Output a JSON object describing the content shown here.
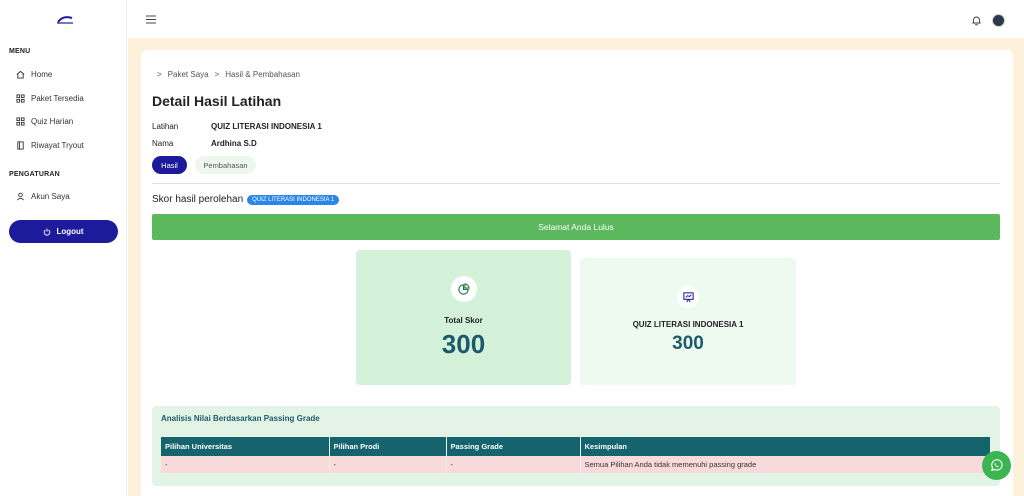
{
  "sidebar": {
    "menu_heading": "MENU",
    "settings_heading": "PENGATURAN",
    "items": [
      {
        "label": "Home",
        "icon": "home-icon"
      },
      {
        "label": "Paket Tersedia",
        "icon": "grid-icon"
      },
      {
        "label": "Quiz Harian",
        "icon": "grid-icon"
      },
      {
        "label": "Riwayat Tryout",
        "icon": "book-icon"
      }
    ],
    "settings_items": [
      {
        "label": "Akun Saya",
        "icon": "user-icon"
      }
    ],
    "logout_label": "Logout"
  },
  "breadcrumb": {
    "items": [
      "Paket Saya",
      "Hasil & Pembahasan"
    ],
    "separator": ">"
  },
  "page": {
    "title": "Detail Hasil Latihan",
    "latihan_label": "Latihan",
    "latihan_value": "QUIZ LITERASI INDONESIA 1",
    "nama_label": "Nama",
    "nama_value": "Ardhina S.D"
  },
  "tabs": {
    "hasil": "Hasil",
    "pembahasan": "Pembahasan"
  },
  "score": {
    "heading": "Skor hasil perolehan",
    "badge": "QUIZ LITERASI INDONESIA 1",
    "banner": "Selamat Anda Lulus",
    "total_label": "Total Skor",
    "total_value": "300",
    "quiz_label": "QUIZ LITERASI INDONESIA 1",
    "quiz_value": "300"
  },
  "analysis": {
    "title": "Analisis Nilai Berdasarkan Passing Grade",
    "columns": [
      "Pilihan Universitas",
      "Pilihan Prodi",
      "Passing Grade",
      "Kesimpulan"
    ],
    "rows": [
      [
        "-",
        "-",
        "-",
        "Semua Pilihan Anda tidak memenuhi passing grade"
      ]
    ]
  },
  "colors": {
    "primary": "#1d1a9c",
    "success": "#5cb85c",
    "table_header": "#15646d",
    "fail_row": "#f9dada",
    "whatsapp": "#3cb551"
  }
}
